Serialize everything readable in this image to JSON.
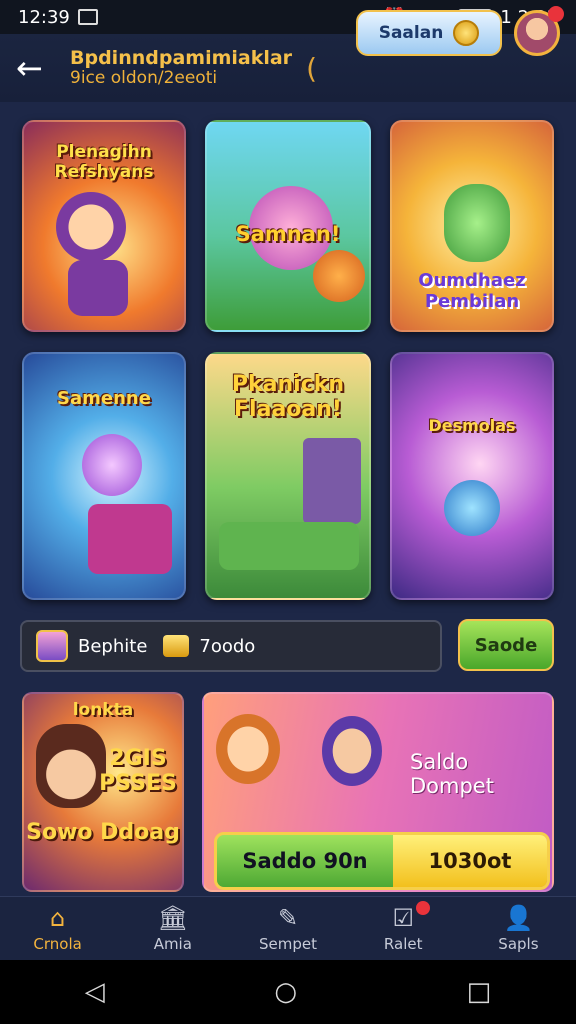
{
  "status_bar": {
    "time": "12:39",
    "right_time": "1 2:23"
  },
  "header": {
    "title": "Bpdinndpamimiaklar",
    "subtitle": "9ice oldon/2eeoti",
    "paren": "(",
    "button_label": "Saalan"
  },
  "cards": [
    {
      "title": "Plenagihn Refshyans"
    },
    {
      "title": "Samnan!"
    },
    {
      "title": "Oumdhaez Pembilan"
    },
    {
      "title": "Samenne"
    },
    {
      "title": "Pkanickn Flaaoan!"
    },
    {
      "title": "Desmolas"
    }
  ],
  "balance": {
    "name": "Bephite",
    "amount": "7oodo",
    "button": "Saode"
  },
  "promo_left": {
    "top": "lonkta",
    "mid": "2GIS PSSES",
    "bottom": "Sowo Ddoag"
  },
  "promo_right": {
    "label": "Saldo Dompet",
    "bar_left": "Saddo 90n",
    "bar_right": "1030ot"
  },
  "bottom_nav": [
    {
      "label": "Crnola",
      "icon": "home-icon"
    },
    {
      "label": "Amia",
      "icon": "bank-icon"
    },
    {
      "label": "Sempet",
      "icon": "pen-icon"
    },
    {
      "label": "Ralet",
      "icon": "inbox-icon"
    },
    {
      "label": "Sapls",
      "icon": "profile-icon"
    }
  ]
}
